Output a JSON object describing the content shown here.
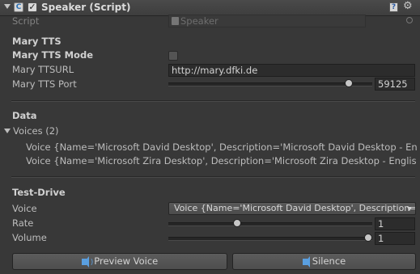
{
  "header": {
    "title": "Speaker (Script)",
    "script_icon": "script-icon",
    "help_icon": "help-icon",
    "gear_icon": "gear-icon",
    "icon_glyphs": {
      "script": "C",
      "check": "✓",
      "help": "?",
      "gear": "⚙",
      "picker": ""
    }
  },
  "script_field": {
    "label": "Script",
    "value": "Speaker"
  },
  "mary": {
    "section": "Mary TTS",
    "mode_label": "Mary TTS Mode",
    "mode_checked": false,
    "url_label": "Mary TTSURL",
    "url_value": "http://mary.dfki.de",
    "port_label": "Mary TTS Port",
    "port_value": "59125",
    "port_slider_fraction": 0.9
  },
  "data": {
    "section": "Data",
    "voices_label": "Voices (2)",
    "voices": [
      "Voice {Name='Microsoft David Desktop', Description='Microsoft David Desktop - English (United States)'",
      "Voice {Name='Microsoft Zira Desktop', Description='Microsoft Zira Desktop - English (United States)'"
    ]
  },
  "test_drive": {
    "section": "Test-Drive",
    "voice_label": "Voice",
    "voice_value": "Voice {Name='Microsoft David Desktop', Description='Microsoft David Desktop - English'",
    "rate_label": "Rate",
    "rate_value": "1",
    "rate_slider_fraction": 0.33,
    "volume_label": "Volume",
    "volume_value": "1",
    "volume_slider_fraction": 1.0
  },
  "buttons": {
    "preview_label": "Preview Voice",
    "silence_label": "Silence"
  },
  "colors": {
    "accent": "#5a9fe0",
    "background": "#383838"
  }
}
